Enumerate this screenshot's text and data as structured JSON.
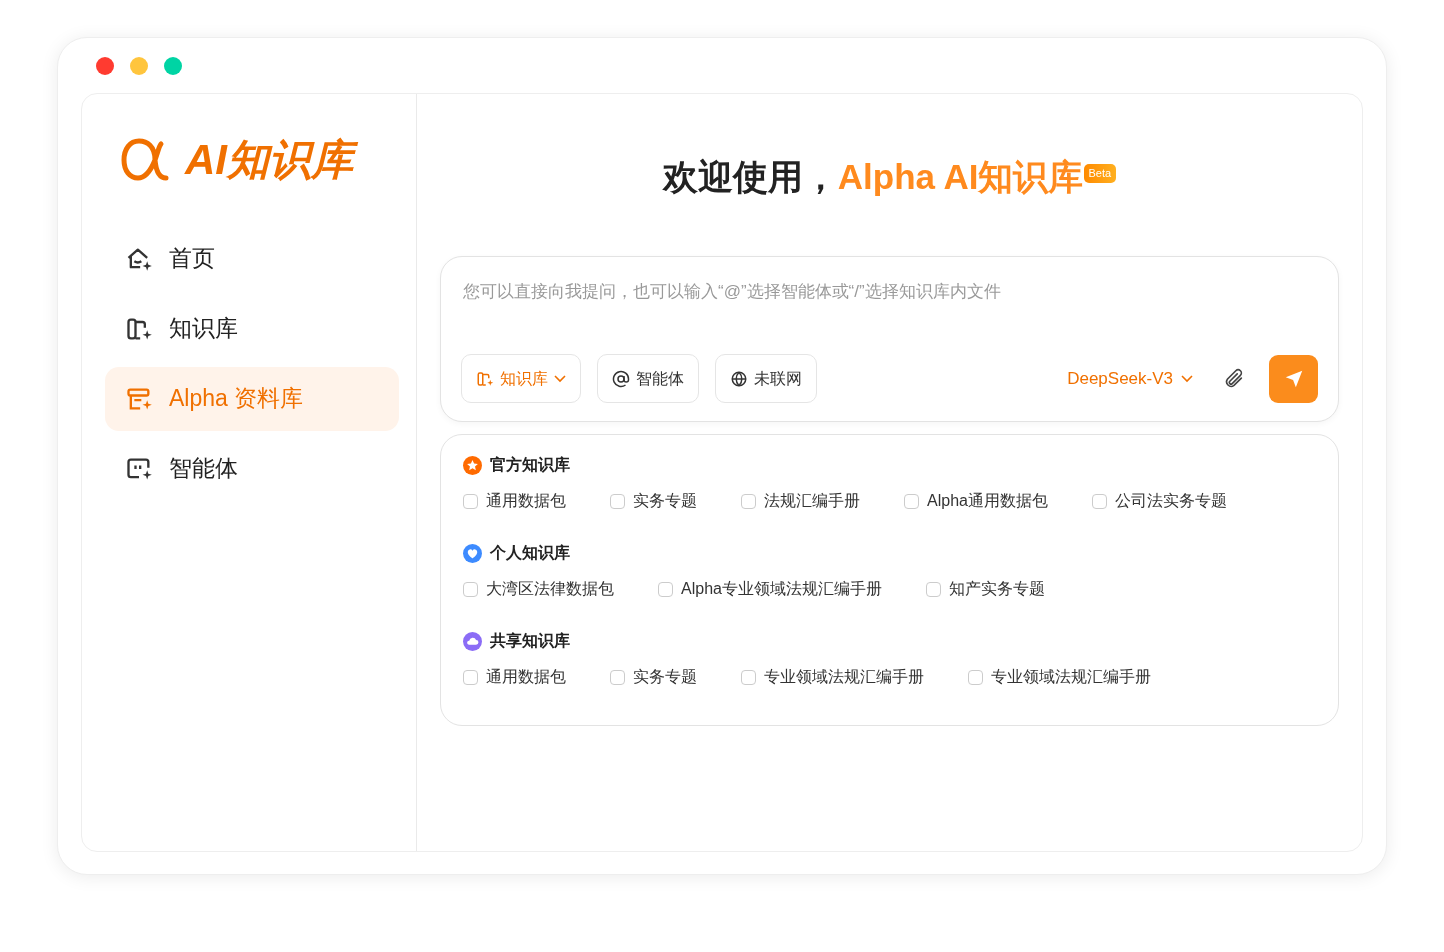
{
  "window": {
    "controls": [
      {
        "color": "#ff3b30"
      },
      {
        "color": "#ffc53d"
      },
      {
        "color": "#00d4a4"
      }
    ]
  },
  "sidebar": {
    "logo": "AI知识库",
    "items": [
      {
        "kind": "home",
        "label": "首页",
        "selected": false
      },
      {
        "kind": "book",
        "label": "知识库",
        "selected": false
      },
      {
        "kind": "archive",
        "label": "Alpha 资料库",
        "selected": true
      },
      {
        "kind": "agent",
        "label": "智能体",
        "selected": false
      }
    ]
  },
  "welcome": {
    "prefix": "欢迎使用，",
    "highlight": "Alpha AI知识库",
    "badge": "Beta"
  },
  "composer": {
    "placeholder": "您可以直接向我提问，也可以输入“@”选择智能体或“/”选择知识库内文件",
    "tools": [
      {
        "kind": "knowledge",
        "label": "知识库",
        "active": true
      },
      {
        "kind": "agent",
        "label": "智能体",
        "active": false
      },
      {
        "kind": "web",
        "label": "未联网",
        "active": false
      }
    ],
    "model": "DeepSeek-V3"
  },
  "sections": [
    {
      "kind": "star",
      "title": "官方知识库",
      "color": "#ff6a00",
      "items": [
        {
          "label": "通用数据包",
          "checked": false
        },
        {
          "label": "实务专题",
          "checked": false
        },
        {
          "label": "法规汇编手册",
          "checked": false
        },
        {
          "label": "Alpha通用数据包",
          "checked": false
        },
        {
          "label": "公司法实务专题",
          "checked": false
        }
      ]
    },
    {
      "kind": "heart",
      "title": "个人知识库",
      "color": "#3d8bff",
      "items": [
        {
          "label": "大湾区法律数据包",
          "checked": false
        },
        {
          "label": "Alpha专业领域法规汇编手册",
          "checked": false
        },
        {
          "label": "知产实务专题",
          "checked": false
        }
      ]
    },
    {
      "kind": "cloud",
      "title": "共享知识库",
      "color": "#8b6cf6",
      "items": [
        {
          "label": "通用数据包",
          "checked": false
        },
        {
          "label": "实务专题",
          "checked": false
        },
        {
          "label": "专业领域法规汇编手册",
          "checked": false
        },
        {
          "label": "专业领域法规汇编手册",
          "checked": false
        }
      ]
    }
  ]
}
